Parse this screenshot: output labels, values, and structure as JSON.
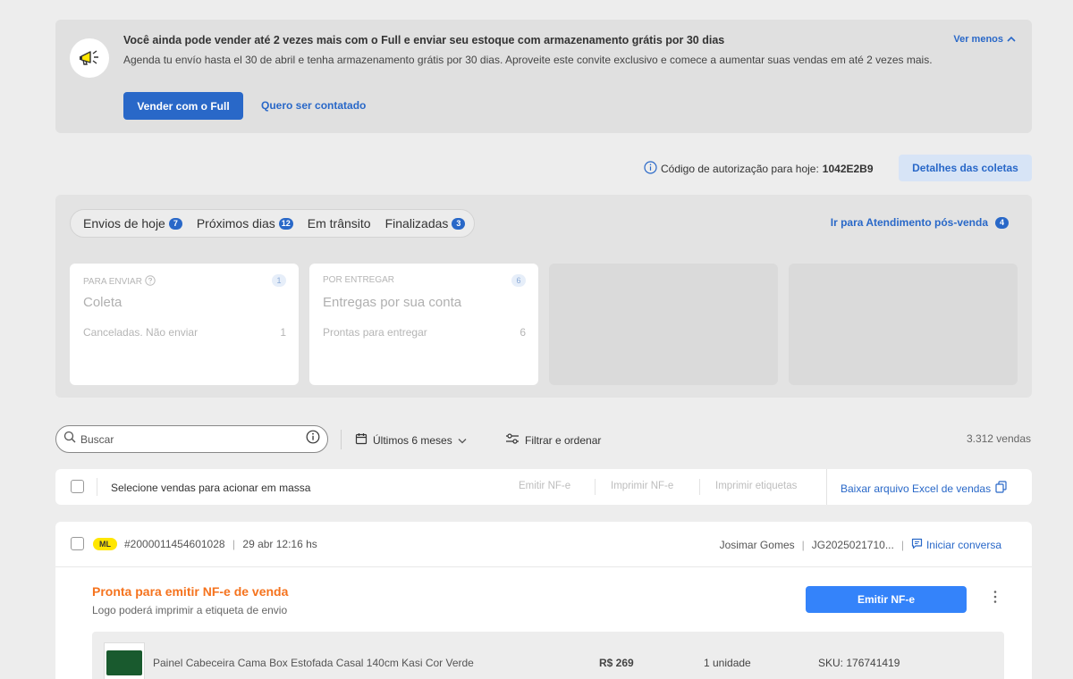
{
  "banner": {
    "title": "Você ainda pode vender até 2 vezes mais com o Full e enviar seu estoque com armazenamento grátis por 30 dias",
    "text": "Agenda tu envío hasta el 30 de abril e tenha armazenamento grátis por 30 dias. Aproveite este convite exclusivo e comece a aumentar suas vendas em até 2 vezes mais.",
    "primary_label": "Vender com o Full",
    "link_label": "Quero ser contatado",
    "toggle_label": "Ver menos",
    "icon": "megaphone-icon"
  },
  "auth": {
    "label": "Código de autorização para hoje:",
    "code": "1042E2B9",
    "details_label": "Detalhes das coletas"
  },
  "tabs": [
    {
      "label": "Envios de hoje",
      "count": "7"
    },
    {
      "label": "Próximos dias",
      "count": "12"
    },
    {
      "label": "Em trânsito",
      "count": ""
    },
    {
      "label": "Finalizadas",
      "count": "3"
    }
  ],
  "posvenda": {
    "label": "Ir para Atendimento pós-venda",
    "count": "4"
  },
  "cards": [
    {
      "label": "PARA ENVIAR",
      "count": "1",
      "title": "Coleta",
      "row_label": "Canceladas. Não enviar",
      "row_value": "1"
    },
    {
      "label": "POR ENTREGAR",
      "count": "6",
      "title": "Entregas por sua conta",
      "row_label": "Prontas para entregar",
      "row_value": "6"
    }
  ],
  "filters": {
    "search_placeholder": "Buscar",
    "period_label": "Últimos 6 meses",
    "filter_label": "Filtrar e ordenar",
    "sales_count": "3.312 vendas"
  },
  "bulk": {
    "label": "Selecione vendas para acionar em massa",
    "emit_nfe": "Emitir NF-e",
    "print_nfe": "Imprimir NF-e",
    "print_labels": "Imprimir etiquetas",
    "excel": "Baixar arquivo Excel de vendas"
  },
  "order": {
    "badge": "ML",
    "id": "#2000011454601028",
    "date": "29 abr 12:16 hs",
    "buyer": "Josimar Gomes",
    "code": "JG2025021710...",
    "chat_label": "Iniciar conversa",
    "status_title": "Pronta para emitir NF-e de venda",
    "status_sub": "Logo poderá imprimir a etiqueta de envio",
    "emit_label": "Emitir NF-e",
    "item": {
      "name": "Painel Cabeceira Cama Box Estofada Casal 140cm Kasi Cor Verde",
      "price": "R$ 269",
      "quantity": "1 unidade",
      "sku": "SKU: 176741419"
    }
  },
  "colors": {
    "accent": "#2968c8",
    "primary_button": "#3483fa",
    "status": "#f5731e",
    "ml_badge": "#ffe600"
  }
}
